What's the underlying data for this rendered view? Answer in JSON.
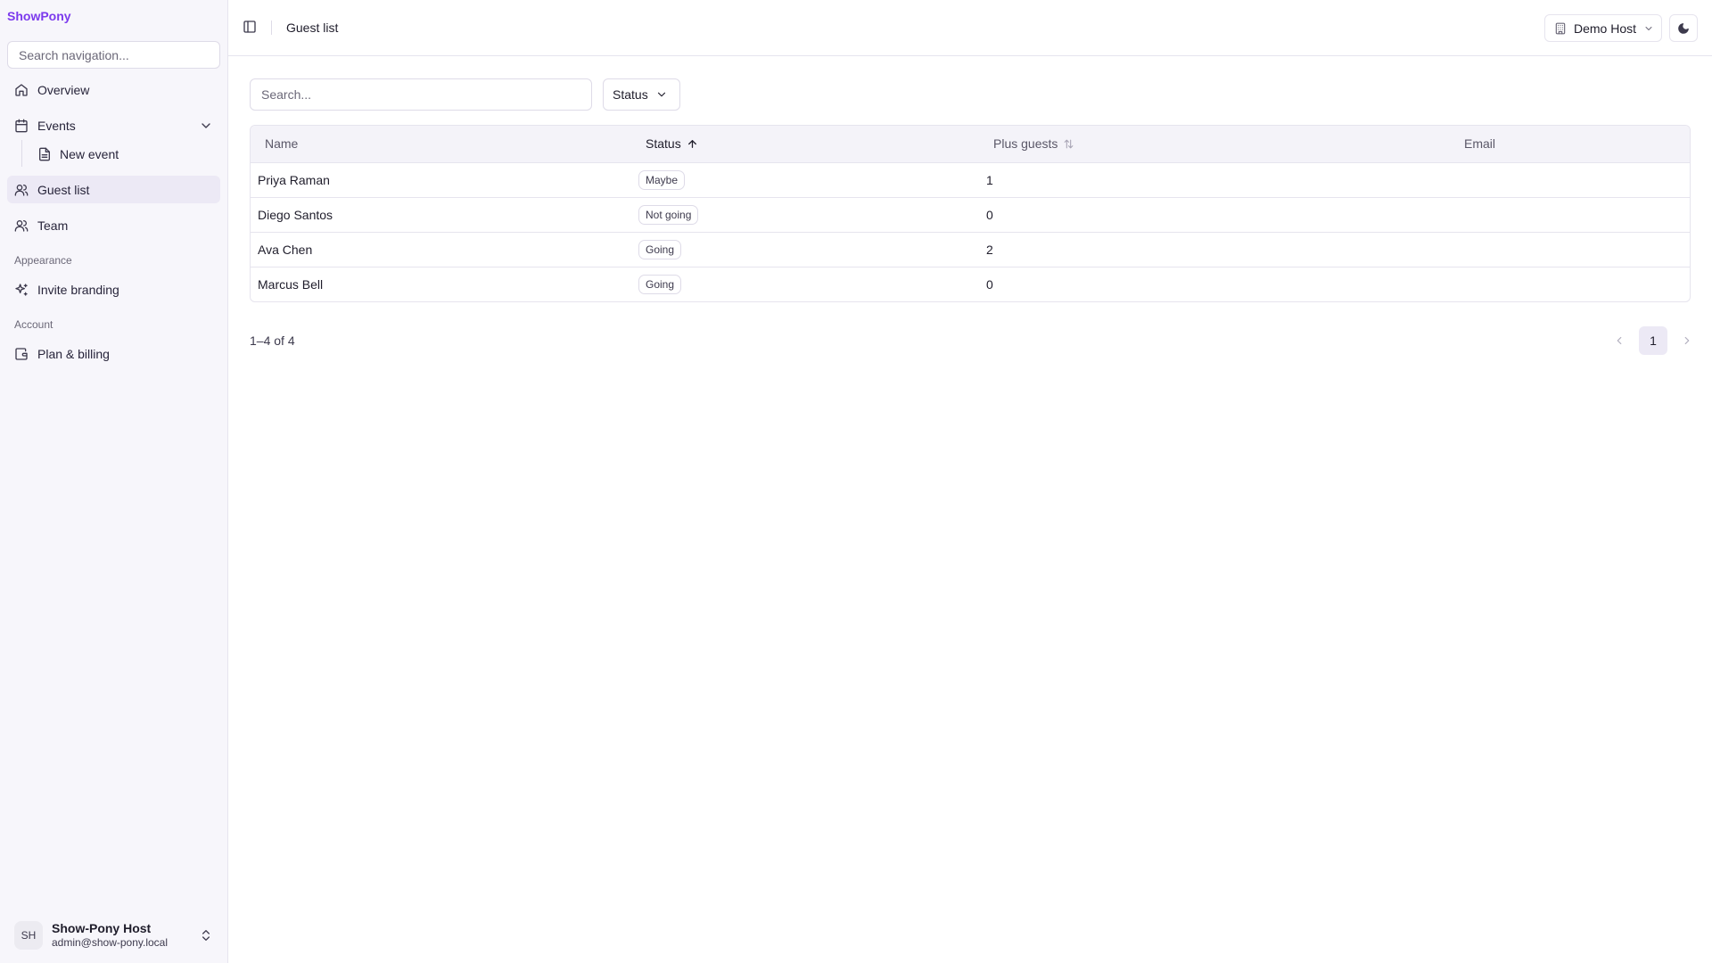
{
  "sidebar": {
    "brand": "ShowPony",
    "search_placeholder": "Search navigation...",
    "items": {
      "overview": "Overview",
      "events": "Events",
      "new_event": "New event",
      "guest_list": "Guest list",
      "team": "Team",
      "invite_branding": "Invite branding",
      "plan_billing": "Plan & billing"
    },
    "sections": {
      "appearance": "Appearance",
      "account": "Account"
    },
    "user": {
      "initials": "SH",
      "name": "Show-Pony Host",
      "email": "admin@show-pony.local"
    }
  },
  "header": {
    "title": "Guest list",
    "host_label": "Demo Host"
  },
  "toolbar": {
    "search_placeholder": "Search...",
    "status_filter_label": "Status"
  },
  "table": {
    "columns": {
      "name": "Name",
      "status": "Status",
      "plus_guests": "Plus guests",
      "email": "Email"
    },
    "rows": [
      {
        "name": "Priya Raman",
        "status": "Maybe",
        "plus_guests": "1",
        "email": ""
      },
      {
        "name": "Diego Santos",
        "status": "Not going",
        "plus_guests": "0",
        "email": ""
      },
      {
        "name": "Ava Chen",
        "status": "Going",
        "plus_guests": "2",
        "email": ""
      },
      {
        "name": "Marcus Bell",
        "status": "Going",
        "plus_guests": "0",
        "email": ""
      }
    ]
  },
  "pagination": {
    "range": "1–4 of 4",
    "current_page": "1"
  },
  "colors": {
    "brand": "#7c3aed",
    "sidebar_bg": "#f7f6fb",
    "active_item_bg": "#ece9f5"
  }
}
